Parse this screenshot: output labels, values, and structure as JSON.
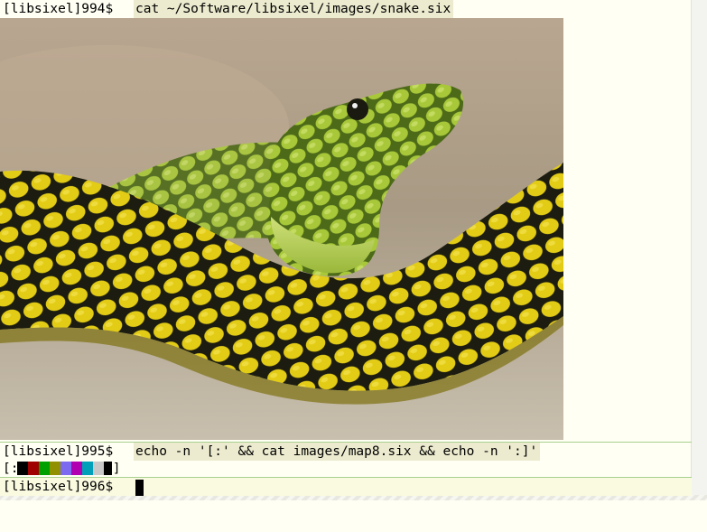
{
  "terminal": {
    "line1": {
      "prompt": "[libsixel]994$ ",
      "command": "cat ~/Software/libsixel/images/snake.six"
    },
    "line2": {
      "prompt": "[libsixel]995$ ",
      "command": "echo -n '[:' && cat images/map8.six && echo -n ':]'"
    },
    "line3": {
      "open": "[:",
      "close": ":]"
    },
    "line4": {
      "prompt": "[libsixel]996$ "
    }
  },
  "image": {
    "subject": "snake-photo"
  },
  "palette": {
    "swatches": [
      "#000000",
      "#a00000",
      "#00a000",
      "#909000",
      "#7c6bf0",
      "#b000b0",
      "#00a0b8",
      "#c8c8c8",
      "#000000"
    ],
    "background": "#fffff4",
    "command_highlight": "#ecebcf",
    "divider": "#a8d08e"
  }
}
